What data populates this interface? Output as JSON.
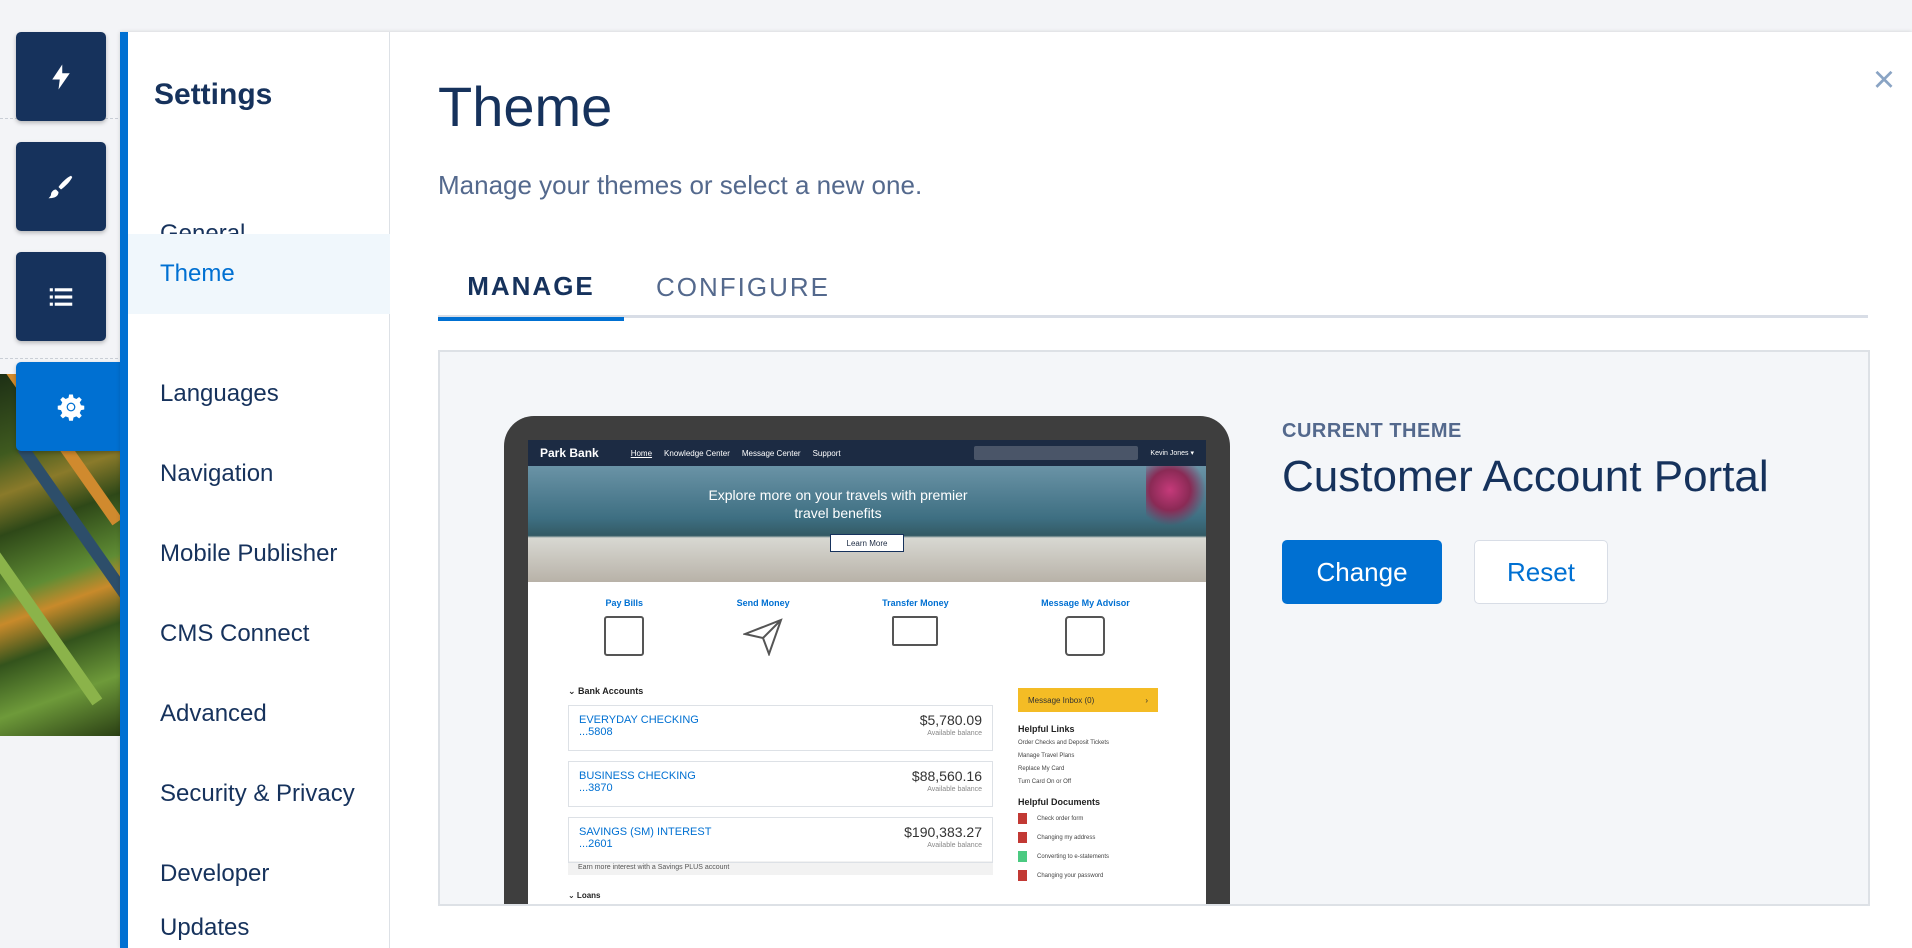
{
  "rail": {
    "items": [
      "lightning-icon",
      "brush-icon",
      "list-icon",
      "gear-icon"
    ]
  },
  "settings": {
    "title": "Settings",
    "nav": [
      "General",
      "Theme",
      "Languages",
      "Navigation",
      "Mobile Publisher",
      "CMS Connect",
      "Advanced",
      "Security & Privacy",
      "Developer",
      "Updates"
    ],
    "active": "Theme"
  },
  "page": {
    "title": "Theme",
    "subtitle": "Manage your themes or select a new one.",
    "close": "×"
  },
  "tabs": {
    "manage": "MANAGE",
    "configure": "CONFIGURE"
  },
  "current_theme": {
    "label": "CURRENT THEME",
    "name": "Customer Account Portal",
    "change": "Change",
    "reset": "Reset"
  },
  "preview": {
    "brand": "Park Bank",
    "links": [
      "Home",
      "Knowledge Center",
      "Message Center",
      "Support"
    ],
    "user": "Kevin Jones ▾",
    "hero_text": "Explore more on your travels with premier travel benefits",
    "hero_button": "Learn More",
    "quick_actions": [
      "Pay Bills",
      "Send Money",
      "Transfer Money",
      "Message My Advisor"
    ],
    "accounts_heading": "⌄  Bank Accounts",
    "accounts": [
      {
        "name": "EVERYDAY CHECKING",
        "num": "...5808",
        "amount": "$5,780.09",
        "label": "Available balance"
      },
      {
        "name": "BUSINESS CHECKING",
        "num": "...3870",
        "amount": "$88,560.16",
        "label": "Available balance"
      },
      {
        "name": "SAVINGS (SM) INTEREST",
        "num": "...2601",
        "amount": "$190,383.27",
        "label": "Available balance"
      }
    ],
    "accounts_note": "Earn more interest with a Savings PLUS account",
    "loans": "⌄  Loans",
    "inbox": "Message Inbox (0)",
    "inbox_chevron": "›",
    "helpful_links_heading": "Helpful Links",
    "helpful_links": [
      "Order Checks and Deposit Tickets",
      "Manage Travel Plans",
      "Replace My Card",
      "Turn Card On or Off"
    ],
    "helpful_docs_heading": "Helpful Documents",
    "helpful_docs": [
      "Check order form",
      "Changing my address",
      "Converting to e-statements",
      "Changing your password"
    ]
  },
  "colors": {
    "accent": "#0070d2",
    "navy": "#16325c"
  }
}
